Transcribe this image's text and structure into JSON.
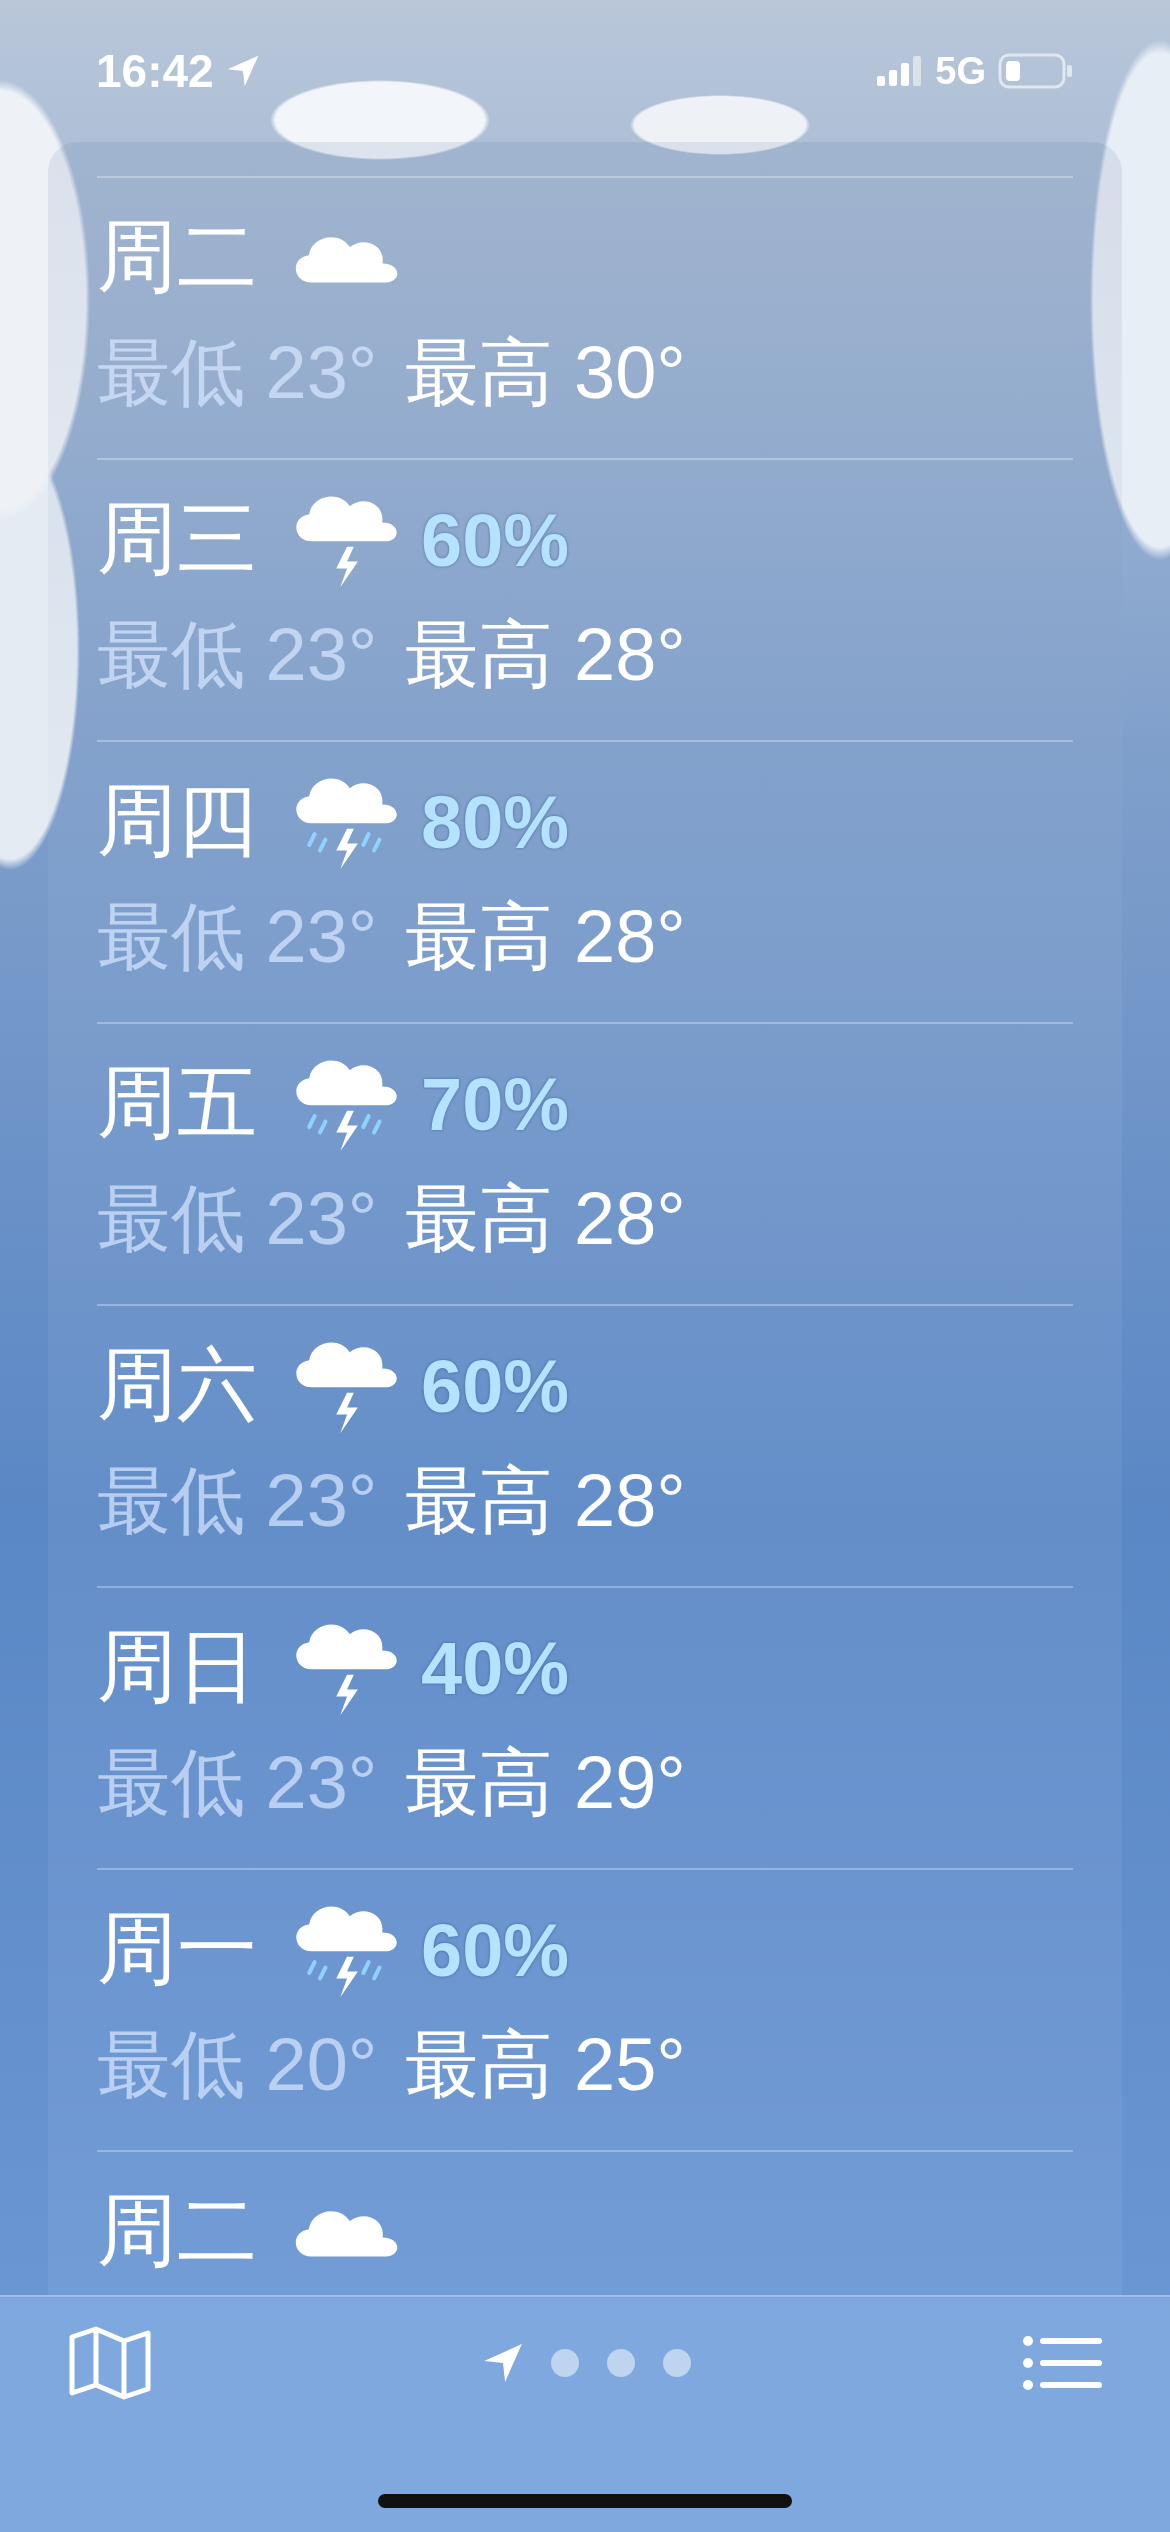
{
  "status_bar": {
    "time": "16:42",
    "network": "5G"
  },
  "forecast": [
    {
      "day": "周二",
      "kind": "cloud",
      "low": "最低 23°",
      "high": "最高 30°"
    },
    {
      "day": "周三",
      "kind": "thunder",
      "precip": "60%",
      "low": "最低 23°",
      "high": "最高 28°"
    },
    {
      "day": "周四",
      "kind": "storm",
      "precip": "80%",
      "low": "最低 23°",
      "high": "最高 28°"
    },
    {
      "day": "周五",
      "kind": "storm",
      "precip": "70%",
      "low": "最低 23°",
      "high": "最高 28°"
    },
    {
      "day": "周六",
      "kind": "thunder",
      "precip": "60%",
      "low": "最低 23°",
      "high": "最高 28°"
    },
    {
      "day": "周日",
      "kind": "thunder",
      "precip": "40%",
      "low": "最低 23°",
      "high": "最高 29°"
    },
    {
      "day": "周一",
      "kind": "storm",
      "precip": "60%",
      "low": "最低 20°",
      "high": "最高 25°"
    },
    {
      "day": "周二",
      "kind": "cloud"
    }
  ],
  "pages": [
    {
      "kind": "location",
      "selected": true
    },
    {
      "kind": "dot",
      "selected": false
    },
    {
      "kind": "dot",
      "selected": false
    },
    {
      "kind": "dot",
      "selected": false
    }
  ]
}
